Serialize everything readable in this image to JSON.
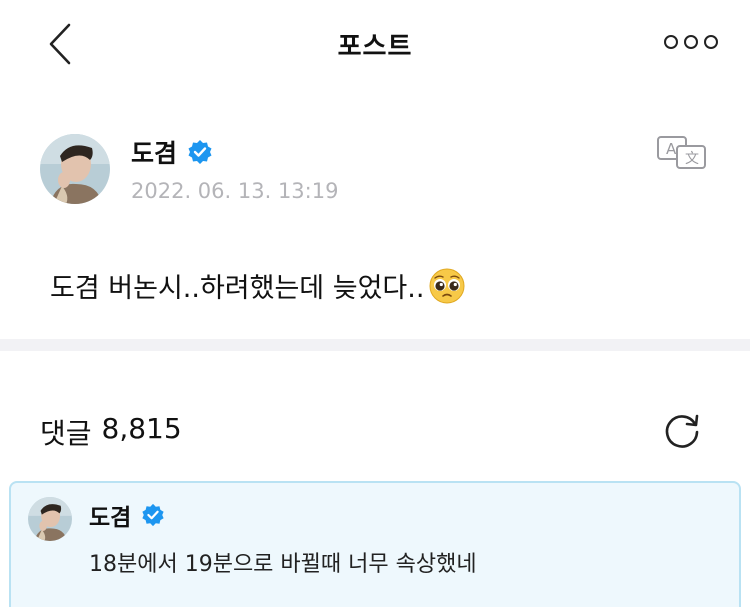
{
  "header": {
    "title": "포스트",
    "back_icon": "chevron-left-icon",
    "more_icon": "more-dots-icon"
  },
  "post": {
    "author": "도겸",
    "verified_icon": "verified-badge-icon",
    "timestamp": "2022. 06. 13. 13:19",
    "translate_icon": "translate-icon",
    "text": "도겸 버논시..하려했는데 늦었다..",
    "emoji": "pleading-face-emoji"
  },
  "comments": {
    "label": "댓글",
    "count": "8,815",
    "refresh_icon": "refresh-icon",
    "items": [
      {
        "author": "도겸",
        "text": "18분에서 19분으로 바뀔때 너무 속상했네"
      }
    ]
  },
  "colors": {
    "verified": "#1d96f0",
    "timestamp": "#b4b4b8",
    "comment_bg": "#eef8fd",
    "comment_border": "#b9e2f3",
    "divider": "#f2f2f5"
  }
}
